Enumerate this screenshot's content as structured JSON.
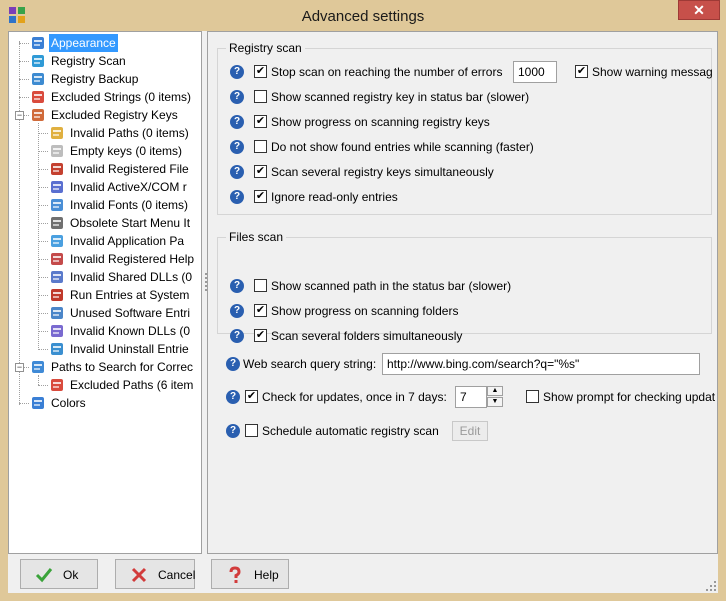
{
  "window": {
    "title": "Advanced settings",
    "close_glyph": "✕"
  },
  "tree": {
    "items": [
      {
        "label": "Appearance",
        "icon": "appearance-icon",
        "selected": true
      },
      {
        "label": "Registry Scan",
        "icon": "registry-scan-icon"
      },
      {
        "label": "Registry Backup",
        "icon": "registry-backup-icon"
      },
      {
        "label": "Excluded Strings (0 items)",
        "icon": "excluded-strings-icon"
      },
      {
        "label": "Excluded Registry Keys",
        "icon": "excluded-registry-keys-icon",
        "expander": "−"
      },
      {
        "label": "Invalid Paths (0 items)",
        "icon": "invalid-paths-icon",
        "child": true
      },
      {
        "label": "Empty keys (0 items)",
        "icon": "empty-keys-icon",
        "child": true
      },
      {
        "label": "Invalid Registered File",
        "icon": "invalid-registered-file-icon",
        "child": true
      },
      {
        "label": "Invalid ActiveX/COM r",
        "icon": "invalid-activex-icon",
        "child": true
      },
      {
        "label": "Invalid Fonts (0 items)",
        "icon": "invalid-fonts-icon",
        "child": true
      },
      {
        "label": "Obsolete Start Menu It",
        "icon": "obsolete-start-menu-icon",
        "child": true
      },
      {
        "label": "Invalid Application Pa",
        "icon": "invalid-application-paths-icon",
        "child": true
      },
      {
        "label": "Invalid Registered Help",
        "icon": "invalid-registered-help-icon",
        "child": true
      },
      {
        "label": "Invalid Shared DLLs (0",
        "icon": "invalid-shared-dlls-icon",
        "child": true
      },
      {
        "label": "Run Entries at System",
        "icon": "run-entries-icon",
        "child": true
      },
      {
        "label": "Unused Software Entri",
        "icon": "unused-software-icon",
        "child": true
      },
      {
        "label": "Invalid Known DLLs (0",
        "icon": "invalid-known-dlls-icon",
        "child": true
      },
      {
        "label": "Invalid Uninstall Entrie",
        "icon": "invalid-uninstall-icon",
        "child": true
      },
      {
        "label": "Paths to Search for Correc",
        "icon": "paths-to-search-icon",
        "expander": "−"
      },
      {
        "label": "Excluded Paths (6 item",
        "icon": "excluded-paths-icon",
        "child": true
      },
      {
        "label": "Colors",
        "icon": "colors-icon"
      }
    ]
  },
  "registry_scan": {
    "title": "Registry scan",
    "stop_scan_label": "Stop scan on reaching the number of errors",
    "stop_scan_checked": true,
    "error_limit_value": "1000",
    "show_warning_label": "Show warning messag",
    "show_warning_checked": true,
    "options": [
      {
        "label": "Show scanned registry key in status bar (slower)",
        "checked": false
      },
      {
        "label": "Show progress on scanning registry keys",
        "checked": true
      },
      {
        "label": "Do not show found entries while scanning (faster)",
        "checked": false
      },
      {
        "label": "Scan several registry keys simultaneously",
        "checked": true
      },
      {
        "label": "Ignore read-only entries",
        "checked": true
      }
    ]
  },
  "files_scan": {
    "title": "Files scan",
    "options": [
      {
        "label": "Show scanned path in the status bar (slower)",
        "checked": false
      },
      {
        "label": "Show progress on scanning folders",
        "checked": true
      },
      {
        "label": "Scan several folders simultaneously",
        "checked": true
      }
    ]
  },
  "web_search": {
    "label": "Web search query string:",
    "value": "http://www.bing.com/search?q=\"%s\""
  },
  "updates": {
    "label": "Check for updates, once in 7 days:",
    "checked": true,
    "days_value": "7",
    "prompt_label": "Show prompt for checking updat",
    "prompt_checked": false
  },
  "schedule": {
    "label": "Schedule automatic registry scan",
    "checked": false,
    "edit_label": "Edit"
  },
  "help_glyph": "?",
  "check_glyph": "✔",
  "buttons": {
    "ok": "Ok",
    "cancel": "Cancel",
    "help": "Help"
  },
  "colors": {
    "frame": "#dfc899",
    "selection": "#3399ff",
    "help_icon": "#2a5fb0",
    "close_button": "#c7504a"
  }
}
